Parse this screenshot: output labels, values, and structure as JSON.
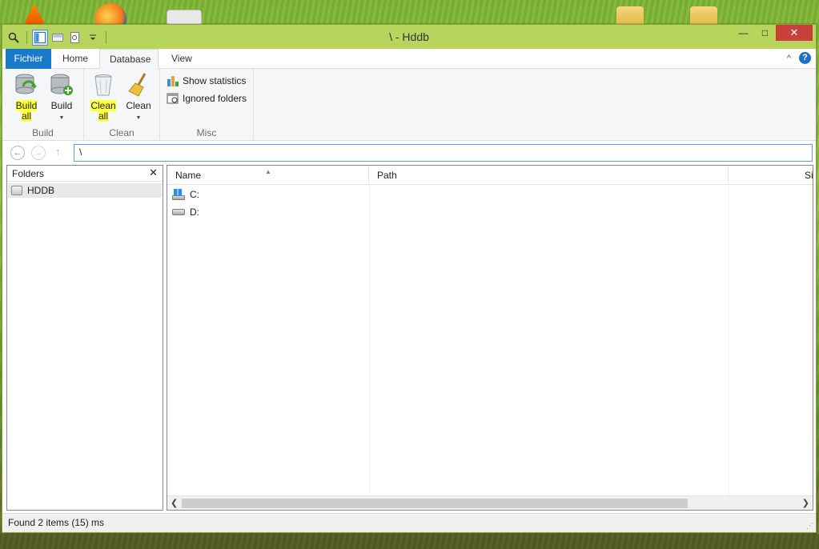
{
  "window": {
    "title": "\\ - Hddb"
  },
  "quick_access": {
    "icons": [
      "search-icon",
      "preview-pane-icon",
      "details-pane-icon",
      "properties-icon",
      "customize-dropdown-icon"
    ]
  },
  "window_controls": {
    "minimize": "—",
    "maximize": "□",
    "close": "✕"
  },
  "ribbon_tabs": {
    "file": "Fichier",
    "home": "Home",
    "database": "Database",
    "view": "View",
    "active": "Database"
  },
  "ribbon": {
    "build_group": {
      "label": "Build",
      "build_all_line1": "Build",
      "build_all_line2": "all",
      "build_line1": "Build",
      "build_caret": "▼"
    },
    "clean_group": {
      "label": "Clean",
      "clean_all_line1": "Clean",
      "clean_all_line2": "all",
      "clean_line1": "Clean",
      "clean_caret": "▼"
    },
    "misc_group": {
      "label": "Misc",
      "show_statistics": "Show statistics",
      "ignored_folders": "Ignored folders"
    }
  },
  "navigation": {
    "back": "←",
    "forward": "→",
    "up": "↑",
    "address_value": "\\"
  },
  "folders_pane": {
    "title": "Folders",
    "close": "✕",
    "items": [
      {
        "label": "HDDB"
      }
    ]
  },
  "list_view": {
    "columns": {
      "name": "Name",
      "path": "Path",
      "size": "Si"
    },
    "rows": [
      {
        "name": "C:",
        "path": ""
      },
      {
        "name": "D:",
        "path": ""
      }
    ]
  },
  "status_bar": {
    "text": "Found 2 items (15) ms"
  },
  "colors": {
    "titlebar": "#b7d45d",
    "file_tab": "#1979ca",
    "highlight": "#ffff3a",
    "close_button": "#c9403a"
  }
}
